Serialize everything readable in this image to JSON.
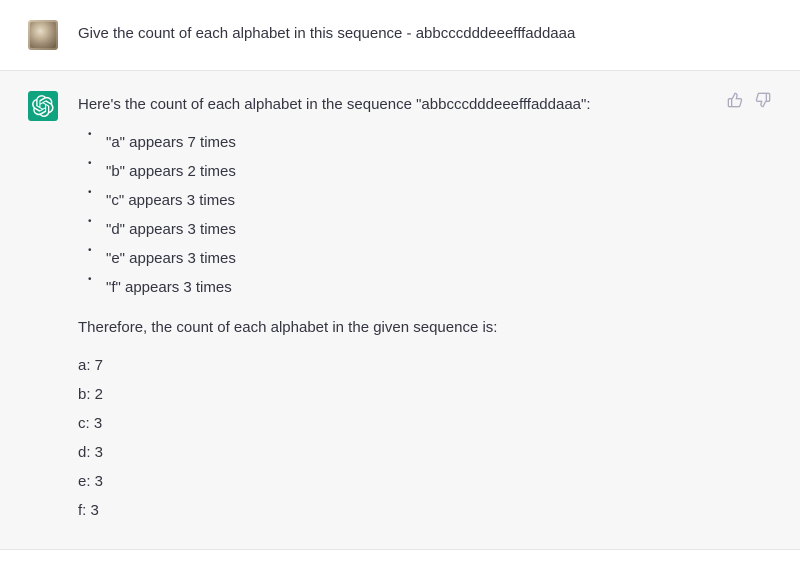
{
  "user": {
    "prompt": "Give the count of each alphabet in this sequence - abbcccdddeeefffaddaaa"
  },
  "assistant": {
    "intro": "Here's the count of each alphabet in the sequence \"abbcccdddeeefffaddaaa\":",
    "bullets": [
      "\"a\" appears 7 times",
      "\"b\" appears 2 times",
      "\"c\" appears 3 times",
      "\"d\" appears 3 times",
      "\"e\" appears 3 times",
      "\"f\" appears 3 times"
    ],
    "summary": "Therefore, the count of each alphabet in the given sequence is:",
    "tally": [
      "a: 7",
      "b: 2",
      "c: 3",
      "d: 3",
      "e: 3",
      "f: 3"
    ]
  }
}
